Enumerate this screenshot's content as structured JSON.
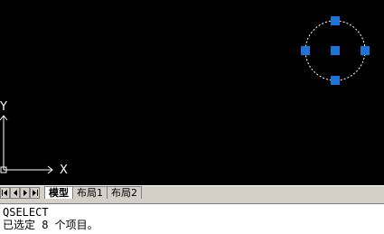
{
  "viewport": {
    "axis_labels": {
      "x": "X",
      "y": "Y"
    },
    "colors": {
      "background": "#000000",
      "grip": "#1e73d6",
      "geometry": "#ffffff"
    }
  },
  "tabs": {
    "nav_buttons": [
      "first-tab",
      "previous-tab",
      "next-tab",
      "last-tab"
    ],
    "items": [
      {
        "label": "模型",
        "active": true
      },
      {
        "label": "布局1",
        "active": false
      },
      {
        "label": "布局2",
        "active": false
      }
    ]
  },
  "command_line": {
    "lines": [
      "QSELECT",
      "已选定 8 个项目。"
    ]
  }
}
